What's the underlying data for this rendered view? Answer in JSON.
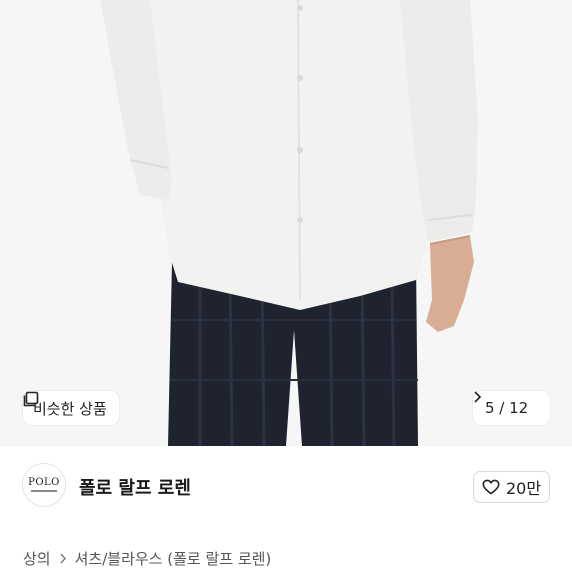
{
  "hero": {
    "image_alt": "white shirt with dark plaid trousers",
    "similar_label": "비슷한 상품",
    "counter": "5 / 12"
  },
  "seller": {
    "logo_text": "POLO",
    "brand": "폴로 랄프 로렌",
    "likes": "20만"
  },
  "breadcrumb": {
    "items": [
      "상의",
      "셔츠/블라우스 (폴로 랄프 로렌)"
    ]
  },
  "colors": {
    "chip_bg": "#ffffff",
    "trousers": "#1f2330",
    "shirt": "#f4f4f2"
  }
}
